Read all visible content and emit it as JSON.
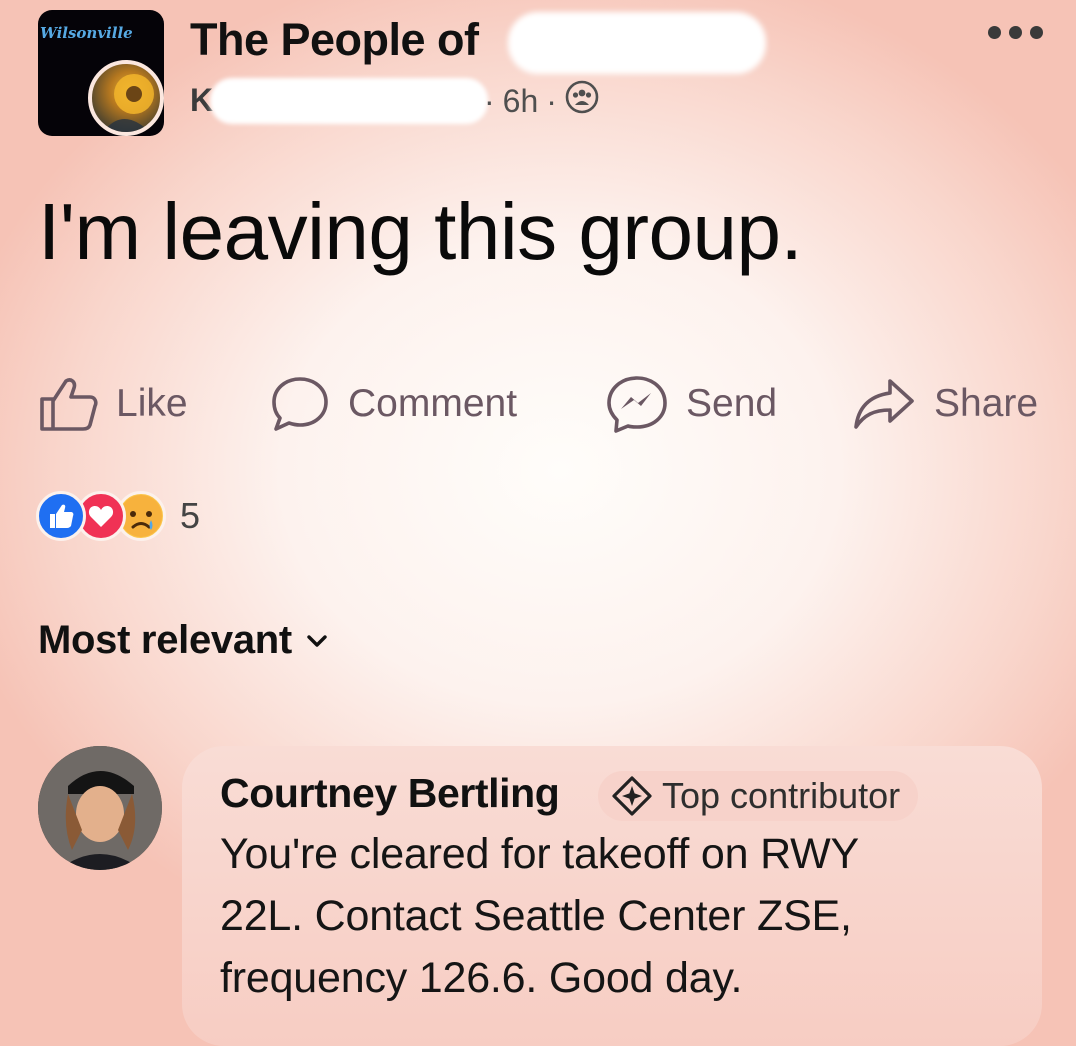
{
  "post": {
    "group_name": "The People of",
    "group_logo_text": "Wilsonville",
    "author_initial": "K",
    "time": "6h",
    "separator": "·",
    "privacy_icon": "group-members-icon",
    "text": "I'm leaving this group."
  },
  "actions": {
    "like": "Like",
    "comment": "Comment",
    "send": "Send",
    "share": "Share"
  },
  "reactions": {
    "types": [
      "like",
      "love",
      "sad"
    ],
    "count": "5"
  },
  "comments_sort": {
    "label": "Most relevant"
  },
  "comment": {
    "author": "Courtney Bertling",
    "badge": "Top contributor",
    "lines": [
      "You're cleared for takeoff on RWY",
      "22L. Contact Seattle Center ZSE,",
      "frequency 126.6. Good day."
    ]
  },
  "colors": {
    "like_blue": "#1f6ff2",
    "love_red": "#f03255",
    "sad_yellow": "#fbc54a",
    "action_text": "#6b5863"
  }
}
